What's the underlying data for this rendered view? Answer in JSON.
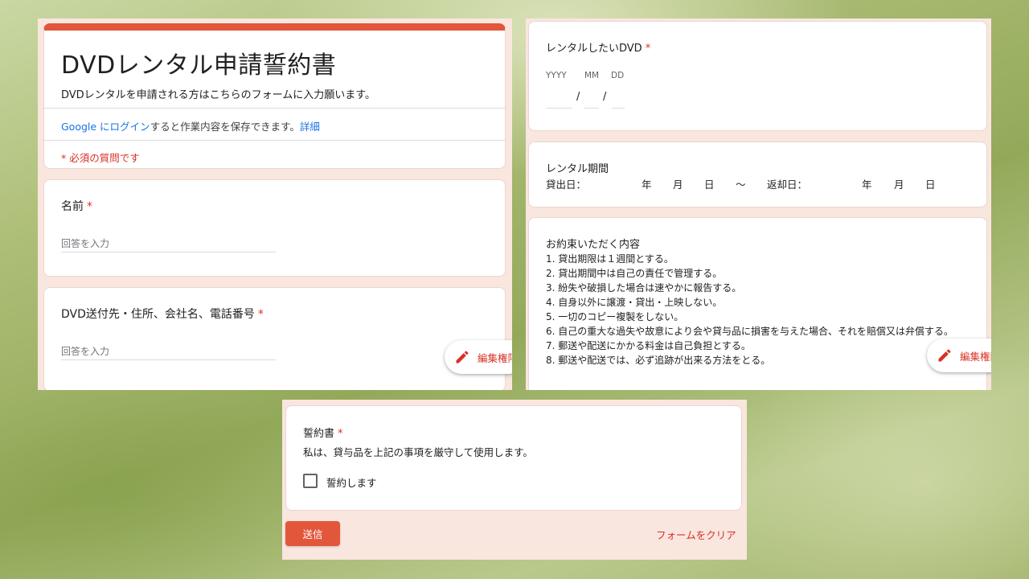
{
  "form": {
    "title": "DVDレンタル申請誓約書",
    "description": "DVDレンタルを申請される方はこちらのフォームに入力願います。",
    "login_link": "Google にログイン",
    "login_rest": "すると作業内容を保存できます。",
    "details_link": "詳細",
    "required_note": "* 必須の質問です"
  },
  "questions": {
    "name": {
      "label": "名前",
      "required_mark": "*",
      "placeholder": "回答を入力"
    },
    "address": {
      "label": "DVD送付先・住所、会社名、電話番号",
      "required_mark": "*",
      "placeholder": "回答を入力"
    },
    "dvd": {
      "label": "レンタルしたいDVD",
      "required_mark": "*",
      "yyyy": "YYYY",
      "mm": "MM",
      "dd": "DD",
      "separator": "/"
    },
    "period": {
      "title": "レンタル期間",
      "loan_label": "貸出日：",
      "return_label": "返却日：",
      "year": "年",
      "month": "月",
      "day": "日",
      "tilde": "〜"
    },
    "terms": {
      "title": "お約束いただく内容",
      "items": [
        "1. 貸出期限は１週間とする。",
        "2. 貸出期間中は自己の責任で管理する。",
        "3. 紛失や破損した場合は速やかに報告する。",
        "4. 自身以外に譲渡・貸出・上映しない。",
        "5. 一切のコピー複製をしない。",
        "6. 自己の重大な過失や故意により会や貸与品に損害を与えた場合、それを賠償又は弁償する。",
        "7. 郵送や配送にかかる料金は自己負担とする。",
        "8. 郵送や配送では、必ず追跡が出来る方法をとる。"
      ]
    },
    "pledge": {
      "label": "誓約書",
      "required_mark": "*",
      "description": "私は、貸与品を上記の事項を厳守して使用します。",
      "checkbox_label": "誓約します",
      "checked": false
    }
  },
  "buttons": {
    "edit_label": "編集権限",
    "submit_label": "送信",
    "clear_label": "フォームをクリア"
  },
  "colors": {
    "accent": "#e2573b",
    "required": "#d93025",
    "link": "#1a73e8",
    "panel_bg": "#f9e6df"
  },
  "icons": {
    "edit": "pencil-icon"
  }
}
